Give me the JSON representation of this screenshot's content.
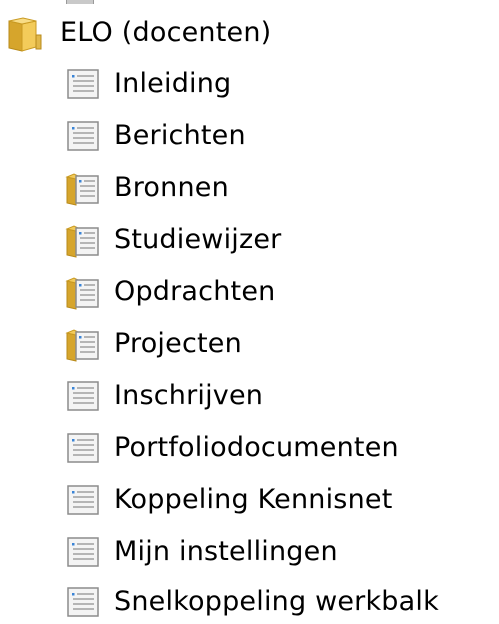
{
  "tree": {
    "root": {
      "label": "ELO (docenten)",
      "icon": "folder-icon"
    },
    "items": [
      {
        "label": "Inleiding",
        "icon": "page-icon"
      },
      {
        "label": "Berichten",
        "icon": "page-icon"
      },
      {
        "label": "Bronnen",
        "icon": "folder-page-icon"
      },
      {
        "label": "Studiewijzer",
        "icon": "folder-page-icon"
      },
      {
        "label": "Opdrachten",
        "icon": "folder-page-icon"
      },
      {
        "label": "Projecten",
        "icon": "folder-page-icon"
      },
      {
        "label": "Inschrijven",
        "icon": "page-icon"
      },
      {
        "label": "Portfoliodocumenten",
        "icon": "page-icon"
      },
      {
        "label": "Koppeling Kennisnet",
        "icon": "page-icon"
      },
      {
        "label": "Mijn instellingen",
        "icon": "page-icon"
      },
      {
        "label": "Snelkoppeling werkbalk",
        "icon": "page-icon"
      }
    ]
  },
  "colors": {
    "folder": "#f0c24e",
    "folder_dark": "#c99a22",
    "page_border": "#8c8c8c",
    "page_lines": "#a0a0a0",
    "page_dot": "#3a84d6"
  }
}
